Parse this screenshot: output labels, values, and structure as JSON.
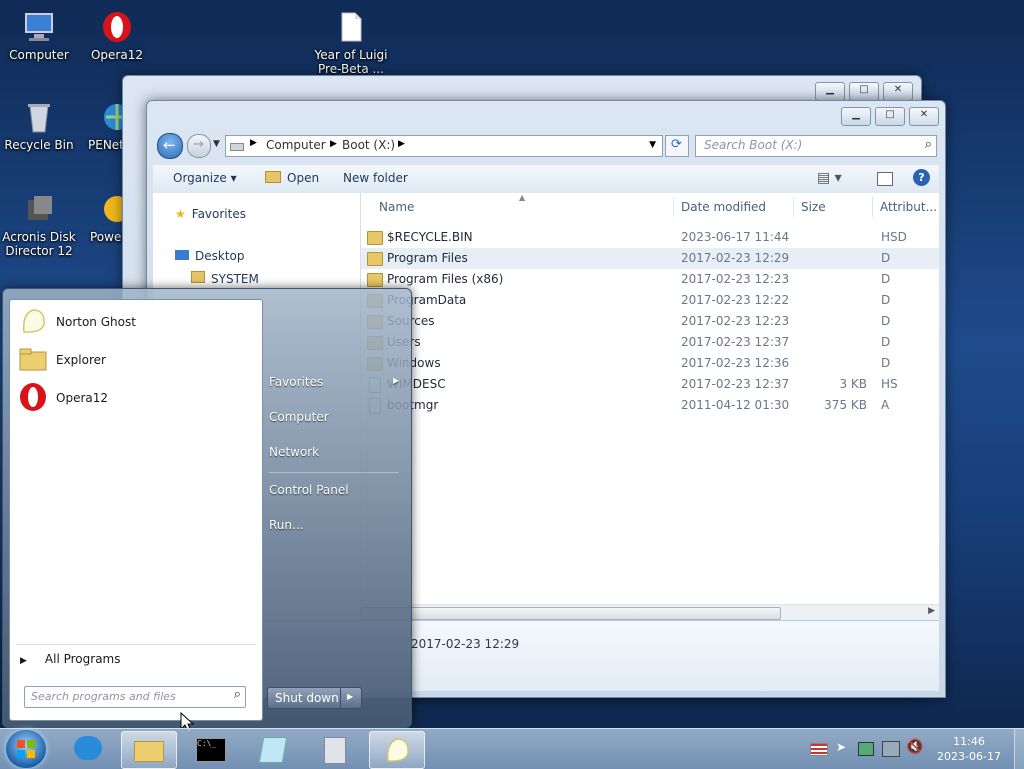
{
  "desktop": {
    "icons": [
      {
        "label": "Computer",
        "icon": "computer-icon"
      },
      {
        "label": "Opera12",
        "icon": "opera-icon"
      },
      {
        "label": "Year of Luigi Pre-Beta ...",
        "icon": "document-icon"
      },
      {
        "label": "Recycle Bin",
        "icon": "recycle-bin-icon"
      },
      {
        "label": "PENet",
        "icon": "network-icon"
      },
      {
        "label": "Acronis Disk Director 12",
        "icon": "acronis-icon"
      },
      {
        "label": "Power",
        "icon": "power-icon"
      }
    ]
  },
  "explorer": {
    "address": {
      "computer": "Computer",
      "drive": "Boot (X:)"
    },
    "search_placeholder": "Search Boot (X:)",
    "toolbar": {
      "organize": "Organize",
      "open": "Open",
      "new_folder": "New folder"
    },
    "nav": {
      "favorites": "Favorites",
      "desktop": "Desktop",
      "system": "SYSTEM"
    },
    "columns": {
      "name": "Name",
      "date": "Date modified",
      "size": "Size",
      "attributes": "Attribut..."
    },
    "files": [
      {
        "name": "$RECYCLE.BIN",
        "date": "2023-06-17 11:44",
        "size": "",
        "attr": "HSD"
      },
      {
        "name": "Program Files",
        "date": "2017-02-23 12:29",
        "size": "",
        "attr": "D"
      },
      {
        "name": "Program Files (x86)",
        "date": "2017-02-23 12:23",
        "size": "",
        "attr": "D"
      },
      {
        "name": "ProgramData",
        "date": "2017-02-23 12:22",
        "size": "",
        "attr": "D"
      },
      {
        "name": "Sources",
        "date": "2017-02-23 12:23",
        "size": "",
        "attr": "D"
      },
      {
        "name": "Users",
        "date": "2017-02-23 12:37",
        "size": "",
        "attr": "D"
      },
      {
        "name": "Windows",
        "date": "2017-02-23 12:36",
        "size": "",
        "attr": "D"
      },
      {
        "name": "WIMDESC",
        "date": "2017-02-23 12:37",
        "size": "3 KB",
        "attr": "HS"
      },
      {
        "name": "bootmgr",
        "date": "2011-04-12 01:30",
        "size": "375 KB",
        "attr": "A"
      }
    ],
    "details_date": "2017-02-23 12:29"
  },
  "start_menu": {
    "programs": [
      {
        "label": "Norton Ghost",
        "icon": "ghost-icon"
      },
      {
        "label": "Explorer",
        "icon": "folder-icon"
      },
      {
        "label": "Opera12",
        "icon": "opera-icon"
      }
    ],
    "all_programs": "All Programs",
    "search_placeholder": "Search programs and files",
    "right_links": {
      "favorites": "Favorites",
      "computer": "Computer",
      "network": "Network",
      "control_panel": "Control Panel",
      "run": "Run..."
    },
    "shutdown": "Shut down"
  },
  "taskbar": {
    "time": "11:46",
    "date": "2023-06-17"
  }
}
